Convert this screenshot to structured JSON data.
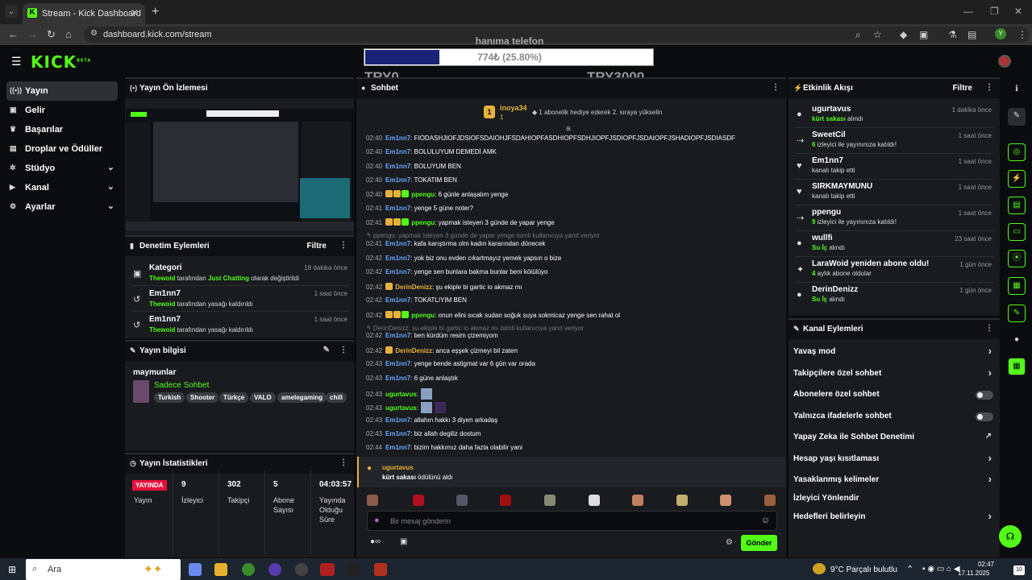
{
  "browser": {
    "tab_title": "Stream - Kick Dashboard",
    "url": "dashboard.kick.com/stream",
    "profile_initial": "Y"
  },
  "header": {
    "logo": "KICK",
    "logo_sup": "BETA",
    "goal": {
      "title": "hanıma telefon",
      "text": "774₺ (25.80%)",
      "progress_percent": 25.8,
      "min_label": "TRY0",
      "max_label": "TRY3000"
    }
  },
  "sidebar": {
    "items": [
      {
        "label": "Yayın",
        "icon": "broadcast-icon",
        "glyph": "((•))",
        "active": true
      },
      {
        "label": "Gelir",
        "icon": "revenue-icon",
        "glyph": "▣"
      },
      {
        "label": "Başarılar",
        "icon": "trophy-icon",
        "glyph": "🏆"
      },
      {
        "label": "Droplar ve Ödüller",
        "icon": "drops-icon",
        "glyph": "▤"
      },
      {
        "label": "Stüdyo",
        "icon": "studio-icon",
        "glyph": "⚙",
        "chevron": true
      },
      {
        "label": "Kanal",
        "icon": "channel-icon",
        "glyph": "▶",
        "chevron": true
      },
      {
        "label": "Ayarlar",
        "icon": "settings-icon",
        "glyph": "⚙",
        "chevron": true
      }
    ]
  },
  "preview": {
    "title": "Yayın Ön İzlemesi"
  },
  "moderation": {
    "title": "Denetim Eylemleri",
    "filter": "Filtre",
    "items": [
      {
        "title": "Kategori",
        "actor": "Thewoid",
        "mid": " tarafından ",
        "target": "Just Chatting",
        "suffix": " olarak değiştirildi",
        "time": "18 dakika önce"
      },
      {
        "title": "Em1nn7",
        "actor": "Thewoid",
        "mid": " tarafından yasağı kaldırıldı",
        "target": "",
        "suffix": "",
        "time": "1 saat önce"
      },
      {
        "title": "Em1nn7",
        "actor": "Thewoid",
        "mid": " tarafından yasağı kaldırıldı",
        "target": "",
        "suffix": "",
        "time": "1 saat önce"
      }
    ]
  },
  "info": {
    "title": "Yayın bilgisi",
    "stream_title": "maymunlar",
    "category": "Sadece Sohbet",
    "tags": [
      "Turkish",
      "Shooter",
      "Türkçe",
      "VALO",
      "amelegaming",
      "chill"
    ]
  },
  "stats": {
    "title": "Yayın İstatistikleri",
    "live_badge": "YAYINDA",
    "live_label": "Yayın",
    "items": [
      {
        "value": "9",
        "label": "İzleyici"
      },
      {
        "value": "302",
        "label": "Takipçi"
      },
      {
        "value": "5",
        "label": "Abone Sayısı"
      },
      {
        "value": "04:03:57",
        "label": "Yayında Olduğu Süre"
      }
    ]
  },
  "chat": {
    "title": "Sohbet",
    "pinned_user": "inoya34",
    "pinned_count": "1",
    "pinned_text": "1 abonelik hediye ederek 2. sıraya yükselin",
    "messages": [
      {
        "time": "02:40",
        "user": "Em1nn7",
        "color": "#6ba8ff",
        "text": ": FIODASHJIOFJDSIOFSDAIOHJFSDAHIOPFASDHIOPFSDHJIOPFJSDIOPFJSDAIOPFJSHADIOPFJSDIASDF"
      },
      {
        "time": "02:40",
        "user": "Em1nn7",
        "color": "#6ba8ff",
        "text": ": BOLULUYUM DEMEDİ AMK"
      },
      {
        "time": "02:40",
        "user": "Em1nn7",
        "color": "#6ba8ff",
        "text": ": BOLUYUM BEN"
      },
      {
        "time": "02:40",
        "user": "Em1nn7",
        "color": "#6ba8ff",
        "text": ": TOKATIM BEN"
      },
      {
        "time": "02:40",
        "user": "ppengu",
        "color": "#53fc18",
        "badges": true,
        "text": ": 6 günle anlaşalım yenge"
      },
      {
        "time": "02:41",
        "user": "Em1nn7",
        "color": "#6ba8ff",
        "text": ": yenge 5 güne noter?"
      },
      {
        "time": "02:41",
        "user": "ppengu",
        "color": "#53fc18",
        "badges": true,
        "text": ": yapmak isteyen 3 günde de yapar yenge"
      },
      {
        "reply": "↰ ppengu: yapmak isteyen 3 günde de yapar yenge isimli kullanıcıya yanıt veriyor"
      },
      {
        "time": "02:41",
        "user": "Em1nn7",
        "color": "#6ba8ff",
        "text": ": kafa karıştırma olm kadın kararından dönecek"
      },
      {
        "time": "02:42",
        "user": "Em1nn7",
        "color": "#6ba8ff",
        "text": ": yok biz onu evden cıkartmayız yemek yapsın o bize"
      },
      {
        "time": "02:42",
        "user": "Em1nn7",
        "color": "#6ba8ff",
        "text": ": yenge sen bunlara bakma bunlar beni kötülüyo"
      },
      {
        "time": "02:42",
        "user": "DerinDenizz",
        "color": "#e8b13a",
        "crown": true,
        "text": ": şu ekiple bi gartic io akmaz mı"
      },
      {
        "time": "02:42",
        "user": "Em1nn7",
        "color": "#6ba8ff",
        "text": ": TOKATLIYIM BEN"
      },
      {
        "time": "02:42",
        "user": "ppengu",
        "color": "#53fc18",
        "badges": true,
        "text": ": onun elini sıcak sudan soğuk suya sokmicaz yenge sen rahat ol"
      },
      {
        "reply": "↰ DerinDenizz: şu ekiple bi gartic io akmaz mı isimli kullanıcıya yanıt veriyor"
      },
      {
        "time": "02:42",
        "user": "Em1nn7",
        "color": "#6ba8ff",
        "text": ": ben kürdüm resim çizemiyom"
      },
      {
        "time": "02:42",
        "user": "DerinDenizz",
        "color": "#e8b13a",
        "crown": true,
        "text": ": anca eşşek çizmeyi bil zaten"
      },
      {
        "time": "02:43",
        "user": "Em1nn7",
        "color": "#6ba8ff",
        "text": ": yenge bende astigmat var 6 gün var orada"
      },
      {
        "time": "02:43",
        "user": "Em1nn7",
        "color": "#6ba8ff",
        "text": ": 6 güne anlaştık"
      },
      {
        "time": "02:43",
        "user": "ugurtavus",
        "color": "#53fc18",
        "text": ":",
        "emote": 1
      },
      {
        "time": "02:43",
        "user": "ugurtavus",
        "color": "#53fc18",
        "text": ":",
        "emote": 2
      },
      {
        "time": "02:43",
        "user": "Em1nn7",
        "color": "#6ba8ff",
        "text": ": allahın hakkı 3 diyen arkadaş"
      },
      {
        "time": "02:43",
        "user": "Em1nn7",
        "color": "#6ba8ff",
        "text": ": biz allah degiliz dostum"
      },
      {
        "time": "02:44",
        "user": "Em1nn7",
        "color": "#6ba8ff",
        "text": ": bizim hakkımız daha fazla olabilir yani"
      }
    ],
    "redeem_user": "ugurtavus",
    "redeem_reward": "kürt sakası",
    "redeem_suffix": " ödülünü aldı",
    "input_placeholder": "Bir mesaj gönderin",
    "infinity": "∞",
    "send": "Gönder"
  },
  "activity": {
    "title": "Etkinlik Akışı",
    "filter": "Filtre",
    "items": [
      {
        "name": "ugurtavus",
        "green": "kürt sakası",
        "rest": " alındı",
        "time": "1 dakika önce",
        "icon": "reward-icon",
        "glyph": "●"
      },
      {
        "name": "SweetCil",
        "green": "6",
        "rest": " izleyici ile yayınınıza katıldı!",
        "time": "1 saat önce",
        "icon": "raid-icon",
        "glyph": "⇢"
      },
      {
        "name": "Em1nn7",
        "green": "",
        "rest": "kanalı takip etti",
        "time": "1 saat önce",
        "icon": "heart-icon",
        "glyph": "♥"
      },
      {
        "name": "SIRKMAYMUNU",
        "green": "",
        "rest": "kanalı takip etti",
        "time": "1 saat önce",
        "icon": "heart-icon",
        "glyph": "♥"
      },
      {
        "name": "ppengu",
        "green": "9",
        "rest": " izleyici ile yayınınıza katıldı!",
        "time": "1 saat önce",
        "icon": "raid-icon",
        "glyph": "⇢"
      },
      {
        "name": "wullfi",
        "green": "Su İç",
        "rest": " alındı",
        "time": "23 saat önce",
        "icon": "reward-icon",
        "glyph": "●"
      },
      {
        "name": "LaraWoid yeniden abone oldu!",
        "green": "4",
        "rest": " aylık abone oldular",
        "time": "1 gün önce",
        "icon": "sparkle-icon",
        "glyph": "✦"
      },
      {
        "name": "DerinDenizz",
        "green": "Su İç",
        "rest": " alındı",
        "time": "1 gün önce",
        "icon": "reward-icon",
        "glyph": "●"
      }
    ]
  },
  "channel_actions": {
    "title": "Kanal Eylemleri",
    "items": [
      {
        "label": "Yavaş mod",
        "kind": "arrow"
      },
      {
        "label": "Takipçilere özel sohbet",
        "kind": "arrow"
      },
      {
        "label": "Abonelere özel sohbet",
        "kind": "toggle"
      },
      {
        "label": "Yalnızca ifadelerle sohbet",
        "kind": "toggle"
      },
      {
        "label": "Yapay Zeka ile Sohbet Denetimi",
        "kind": "external"
      },
      {
        "label": "Hesap yaşı kısıtlaması",
        "kind": "arrow"
      },
      {
        "label": "Yasaklanmış kelimeler",
        "kind": "arrow"
      },
      {
        "label": "İzleyici Yönlendir",
        "kind": "none"
      },
      {
        "label": "Hedefleri belirleyin",
        "kind": "arrow"
      }
    ]
  },
  "taskbar": {
    "search": "Ara",
    "weather": "9°C  Parçalı bulutlu",
    "time": "02:47",
    "date": "17.11.2025",
    "notif": "10"
  },
  "colors": {
    "accent": "#53fc18",
    "goal_fill": "#1a2275",
    "live": "#e8103a"
  }
}
